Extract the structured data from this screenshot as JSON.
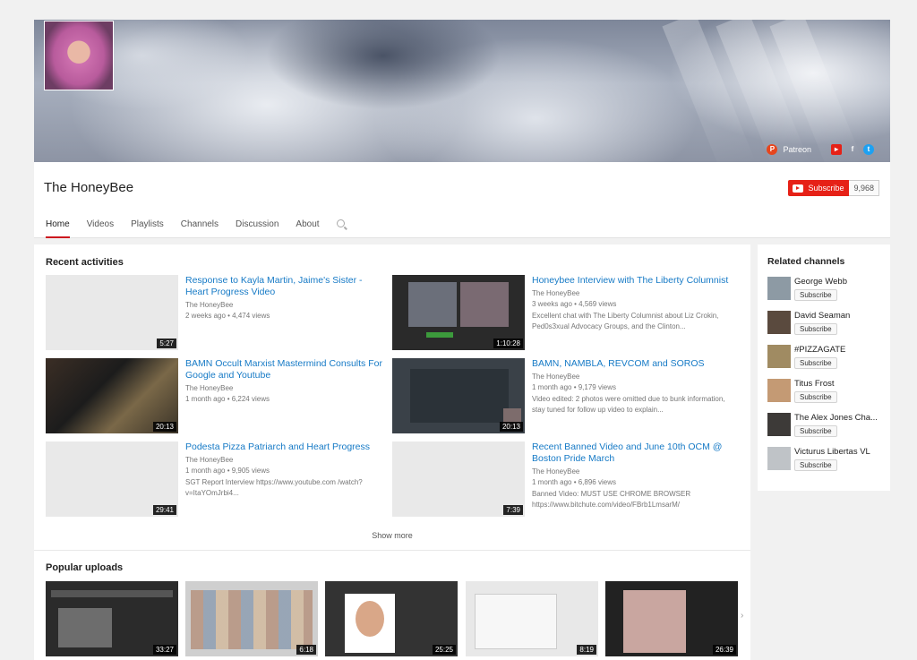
{
  "channel": {
    "name": "The HoneyBee"
  },
  "banner_links": {
    "patreon": "Patreon"
  },
  "subscribe": {
    "label": "Subscribe",
    "count": "9,968"
  },
  "tabs": [
    "Home",
    "Videos",
    "Playlists",
    "Channels",
    "Discussion",
    "About"
  ],
  "recent": {
    "title": "Recent activities",
    "videos": [
      {
        "title": "Response to Kayla Martin, Jaime's Sister - Heart Progress Video",
        "channel": "The HoneyBee",
        "meta": "2 weeks ago • 4,474 views",
        "desc": "",
        "duration": "5:27"
      },
      {
        "title": "Honeybee Interview with The Liberty Columnist",
        "channel": "The HoneyBee",
        "meta": "3 weeks ago • 4,569 views",
        "desc": "Excellent chat with The Liberty Columnist about Liz Crokin, Ped0s3xual Advocacy Groups, and the Clinton...",
        "duration": "1:10:28"
      },
      {
        "title": "BAMN Occult Marxist Mastermind Consults For Google and Youtube",
        "channel": "The HoneyBee",
        "meta": "1 month ago • 6,224 views",
        "desc": "",
        "duration": "20:13"
      },
      {
        "title": "BAMN, NAMBLA, REVCOM and SOROS",
        "channel": "The HoneyBee",
        "meta": "1 month ago • 9,179 views",
        "desc": "Video edited: 2 photos were omitted due to bunk information, stay tuned for follow up video to explain...",
        "duration": "20:13"
      },
      {
        "title": "Podesta Pizza Patriarch and Heart Progress",
        "channel": "The HoneyBee",
        "meta": "1 month ago • 9,905 views",
        "desc": "SGT Report Interview https://www.youtube.com /watch?v=ItaYOmJrbi4...",
        "duration": "29:41"
      },
      {
        "title": "Recent Banned Video and June 10th OCM @ Boston Pride March",
        "channel": "The HoneyBee",
        "meta": "1 month ago • 6,896 views",
        "desc": "Banned Video: MUST USE CHROME BROWSER https://www.bitchute.com/video/FBrb1LmsarM/",
        "duration": "7:39"
      }
    ],
    "show_more": "Show more"
  },
  "popular": {
    "title": "Popular uploads",
    "durations": [
      "33:27",
      "6:18",
      "25:25",
      "8:19",
      "26:39"
    ]
  },
  "related": {
    "title": "Related channels",
    "subscribe_label": "Subscribe",
    "channels": [
      {
        "name": "George Webb"
      },
      {
        "name": "David Seaman"
      },
      {
        "name": "#PIZZAGATE"
      },
      {
        "name": "Titus Frost"
      },
      {
        "name": "The Alex Jones Cha..."
      },
      {
        "name": "Victurus Libertas VL"
      }
    ]
  },
  "colors": {
    "accent_red": "#e62117",
    "link_blue": "#167ac6",
    "tab_underline": "#cc181e"
  }
}
